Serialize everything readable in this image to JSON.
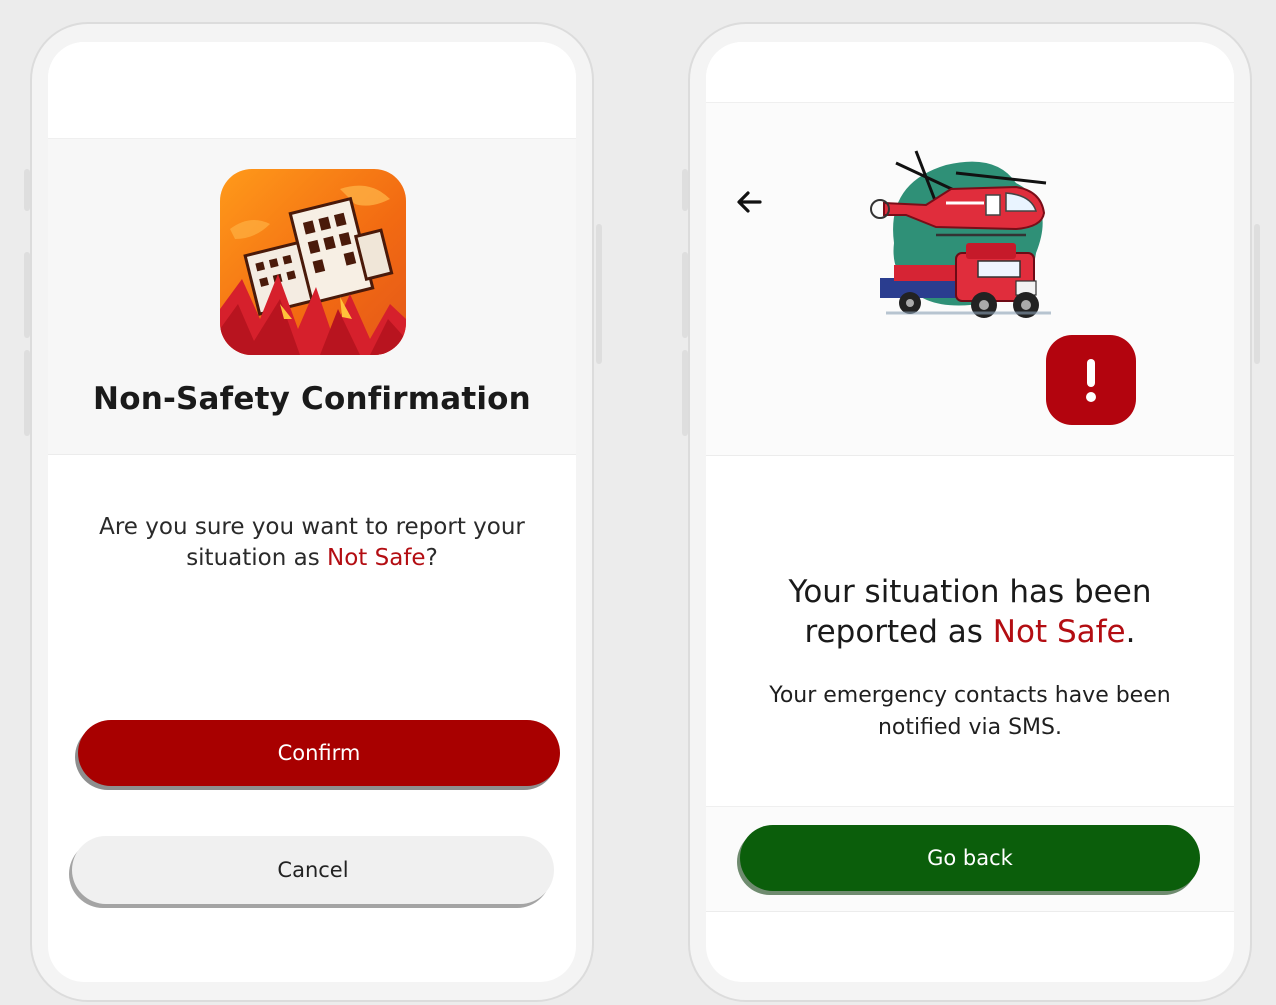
{
  "left_screen": {
    "app_icon": "collapsing-buildings-icon",
    "title": "Non-Safety Confirmation",
    "question_prefix": "Are you sure you want to report your situation as",
    "question_highlight": "Not Safe",
    "question_suffix": "?",
    "confirm_label": "Confirm",
    "cancel_label": "Cancel"
  },
  "right_screen": {
    "back_icon": "arrow-left-icon",
    "illustration": "rescue-helicopter-and-truck-illustration",
    "alert_icon": "exclamation-icon",
    "headline_prefix": "Your situation has been reported as",
    "headline_highlight": "Not Safe",
    "headline_suffix": ".",
    "subtext": "Your emergency contacts have been notified via SMS.",
    "goback_label": "Go back"
  },
  "colors": {
    "danger_red": "#b30d12",
    "confirm_button": "#a80000",
    "goback_button": "#0b5e0b",
    "cancel_button": "#f0f0f0"
  }
}
